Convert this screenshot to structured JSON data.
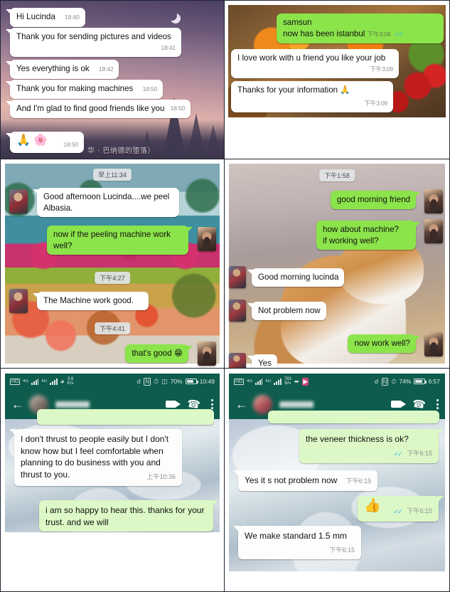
{
  "panels": {
    "p1": {
      "name": "chat-twilight",
      "background_caption": "华 · 巴纳德的堕落）",
      "messages": [
        {
          "side": "in",
          "text": "Hi Lucinda",
          "time": "18:40"
        },
        {
          "side": "in",
          "text": "Thank you for sending pictures and videos",
          "time": "18:41"
        },
        {
          "side": "in",
          "text": "Yes everything is ok",
          "time": "18:42"
        },
        {
          "side": "in",
          "text": "Thank you for making machines",
          "time": "18:50"
        },
        {
          "side": "in",
          "text": "And I'm glad to find good friends like you",
          "time": "18:50"
        },
        {
          "side": "in",
          "text": "🙏 🌸",
          "time": "18:50",
          "emoji_only": true
        }
      ]
    },
    "p2": {
      "name": "chat-market",
      "messages": [
        {
          "side": "out",
          "text": "samsun\nnow has been istanbul",
          "time": "下午3:08",
          "ticks": "✓✓"
        },
        {
          "side": "in",
          "text": "I love work with u friend you like your job",
          "time": "下午3:09"
        },
        {
          "side": "in",
          "text": "Thanks for your information 🙏",
          "time": "下午3:09"
        }
      ]
    },
    "p3": {
      "name": "chat-resort",
      "daystamp": "早上11:34",
      "messages": [
        {
          "side": "in",
          "text": "Good afternoon Lucinda....we peel Albasia.",
          "avatar": "man"
        },
        {
          "side": "out",
          "text": "now if the peeling machine work well?",
          "avatar": "woman"
        },
        {
          "side": "stamp",
          "text": "下午4:27"
        },
        {
          "side": "in",
          "text": "The Machine work good.",
          "avatar": "man"
        },
        {
          "side": "stamp",
          "text": "下午4:41"
        },
        {
          "side": "out",
          "text": "that's good 😁",
          "avatar": "woman"
        }
      ]
    },
    "p4": {
      "name": "chat-dog",
      "daystamp": "下午1:58",
      "messages": [
        {
          "side": "out",
          "text": "good morning friend",
          "avatar": "woman"
        },
        {
          "side": "out",
          "text": "how about machine?\nif working well?",
          "avatar": "woman"
        },
        {
          "side": "in",
          "text": "Good morning lucinda",
          "avatar": "man"
        },
        {
          "side": "in",
          "text": "Not problem now",
          "avatar": "man"
        },
        {
          "side": "out",
          "text": "now work well?",
          "avatar": "woman"
        },
        {
          "side": "in",
          "text": "Yes",
          "avatar": "man"
        }
      ]
    },
    "p5": {
      "name": "whatsapp-screenshot-trust",
      "statusbar": {
        "hd_label": "HD",
        "network_label": "4G",
        "network_label2": "4G",
        "rate_value": "3.6",
        "rate_unit": "K/s",
        "battery_percent": "70%",
        "clock": "10:49"
      },
      "messages": [
        {
          "side": "in",
          "text": "I don't thrust to people easily but I  don't know how but I feel comfortable when planning to do business with you and thrust to you.",
          "time": "上午10:36"
        },
        {
          "side": "out",
          "text": "i am so happy to hear this. thanks for your trust. and we will"
        }
      ]
    },
    "p6": {
      "name": "whatsapp-screenshot-veneer",
      "statusbar": {
        "hd_label": "HD",
        "network_label": "4G",
        "network_label2": "4G",
        "rate_value": "783",
        "rate_unit": "B/s",
        "battery_percent": "74%",
        "clock": "6:57"
      },
      "messages": [
        {
          "side": "out",
          "text": "the veneer thickness is ok?",
          "time": "下午6:15",
          "ticks": "✓✓"
        },
        {
          "side": "in",
          "text": "Yes it s not problem now",
          "time": "下午6:15"
        },
        {
          "side": "out",
          "text": "👍",
          "time": "下午6:15",
          "ticks": "✓✓",
          "emoji_only": true
        },
        {
          "side": "in",
          "text": "We make standard 1.5 mm",
          "time": "下午6:15"
        }
      ]
    }
  },
  "colors": {
    "bubble_out_green": "#8ce44b",
    "whatsapp_out_green": "#dcf8c6",
    "whatsapp_header": "#0d5c4e",
    "tick_blue": "#34b7f1",
    "panel_border": "#1f2533"
  }
}
